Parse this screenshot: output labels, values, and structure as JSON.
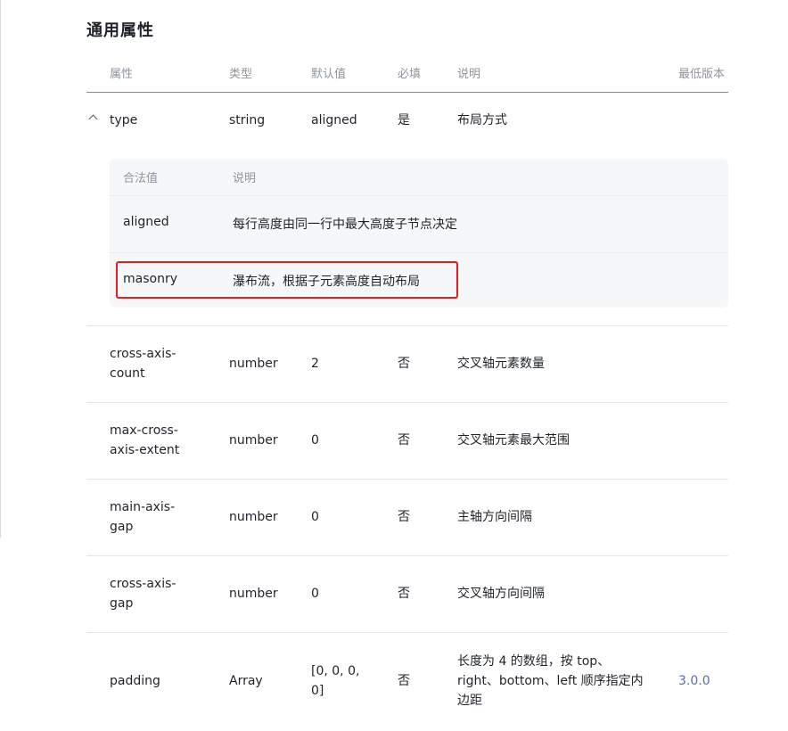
{
  "section_title": "通用属性",
  "headers": {
    "attr": "属性",
    "type": "类型",
    "default": "默认值",
    "required": "必填",
    "desc": "说明",
    "version": "最低版本"
  },
  "type_row": {
    "name": "type",
    "type": "string",
    "default": "aligned",
    "required": "是",
    "desc": "布局方式"
  },
  "sub_table": {
    "headers": {
      "value": "合法值",
      "desc": "说明"
    },
    "rows": [
      {
        "value": "aligned",
        "desc": "每行高度由同一行中最大高度子节点决定"
      },
      {
        "value": "masonry",
        "desc": "瀑布流，根据子元素高度自动布局"
      }
    ]
  },
  "rows": [
    {
      "name_l1": "cross-axis-",
      "name_l2": "count",
      "type": "number",
      "default": "2",
      "required": "否",
      "desc": "交叉轴元素数量"
    },
    {
      "name_l1": "max-cross-",
      "name_l2": "axis-extent",
      "type": "number",
      "default": "0",
      "required": "否",
      "desc": "交叉轴元素最大范围"
    },
    {
      "name_l1": "main-axis-",
      "name_l2": "gap",
      "type": "number",
      "default": "0",
      "required": "否",
      "desc": "主轴方向间隔"
    },
    {
      "name_l1": "cross-axis-",
      "name_l2": "gap",
      "type": "number",
      "default": "0",
      "required": "否",
      "desc": "交叉轴方向间隔"
    }
  ],
  "padding_row": {
    "name": "padding",
    "type": "Array",
    "default_l1": "[0, 0, 0,",
    "default_l2": "0]",
    "required": "否",
    "desc_l1": "长度为 4 的数组，按 top、",
    "desc_l2": "right、bottom、left 顺序指定内",
    "desc_l3": "边距",
    "version": "3.0.0"
  }
}
